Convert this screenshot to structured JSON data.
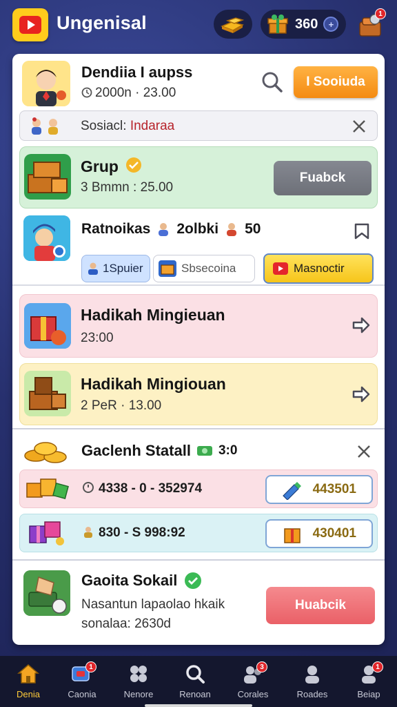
{
  "app": {
    "title": "Ungenisal"
  },
  "topbar": {
    "coins": "360",
    "plus": "+"
  },
  "profile": {
    "name": "Dendiia I aupss",
    "meta": "2000n · 23.00",
    "button": "I Sooiuda"
  },
  "search": {
    "label": "Sosiacl: ",
    "value": "Indaraa"
  },
  "group_card": {
    "title": "Grup",
    "subtitle": "3 Bmmn : 25.00",
    "button": "Fuabck"
  },
  "pt_section": {
    "title": "Ratnoikas",
    "count1": "2olbki",
    "count2": "50",
    "chip1": "1Spuier",
    "chip2": "Sbsecoina",
    "chip3": "Masnoctir"
  },
  "pink_card": {
    "title": "Hadikah Mingieuan",
    "subtitle": "23:00"
  },
  "yellow_card": {
    "title": "Hadikah Mingiouan",
    "subtitle": "2  PeR · 13.00"
  },
  "gs_section": {
    "title": "Gaclenh Statall",
    "badge": "3:0",
    "row1_text": "4338 - 0 - 352974",
    "row1_value": "443501",
    "row2_text": "830 - S 998:92",
    "row2_value": "430401"
  },
  "last_card": {
    "title": "Gaoita Sokail",
    "line1": "Nasantun lapaolao hkaik",
    "line2": "sonalaa: 2630d",
    "button": "Huabcik"
  },
  "nav": [
    {
      "label": "Denia",
      "icon": "home-icon",
      "badge": ""
    },
    {
      "label": "Caonia",
      "icon": "chat-icon",
      "badge": "1"
    },
    {
      "label": "Nenore",
      "icon": "puzzle-icon",
      "badge": ""
    },
    {
      "label": "Renoan",
      "icon": "magnifier-icon",
      "badge": ""
    },
    {
      "label": "Corales",
      "icon": "people-icon",
      "badge": "3"
    },
    {
      "label": "Roades",
      "icon": "person-icon",
      "badge": ""
    },
    {
      "label": "Beiap",
      "icon": "profile-icon",
      "badge": "1"
    }
  ],
  "colors": {
    "accent_orange": "#f48b12",
    "nav_active": "#ffcb3a",
    "panel_bg": "#ffffff",
    "bg": "#27306e"
  }
}
